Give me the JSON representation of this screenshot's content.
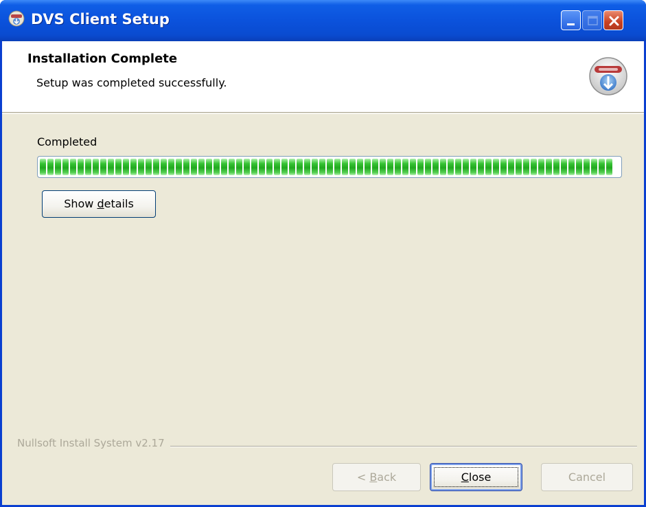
{
  "window": {
    "title": "DVS Client Setup",
    "icon": "installer-icon",
    "controls": {
      "minimize": "minimize-icon",
      "maximize": "maximize-icon",
      "close": "close-icon"
    }
  },
  "header": {
    "title": "Installation Complete",
    "subtitle": "Setup was completed successfully.",
    "icon": "nsis-logo-icon"
  },
  "progress": {
    "label": "Completed",
    "value": 1.0,
    "color": "#21a91f"
  },
  "buttons": {
    "show_details": {
      "pre": "Show ",
      "accel": "d",
      "post": "etails"
    },
    "back": {
      "pre": "< ",
      "accel": "B",
      "post": "ack",
      "enabled": false
    },
    "close": {
      "pre": "",
      "accel": "C",
      "post": "lose",
      "enabled": true
    },
    "cancel": {
      "label": "Cancel",
      "enabled": false
    }
  },
  "branding": "Nullsoft Install System v2.17",
  "colors": {
    "titlebar": "#0b52dc",
    "dialog_bg": "#ece9d8",
    "accent": "#21a91f"
  }
}
